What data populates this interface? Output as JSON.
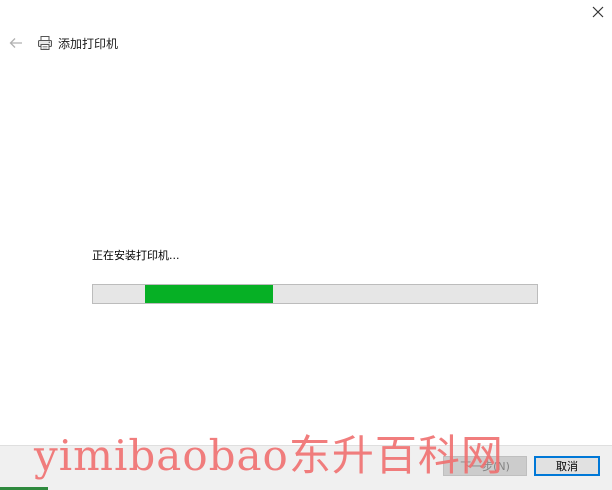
{
  "window": {
    "title": "添加打印机",
    "close_icon": "close-icon",
    "back_icon": "back-arrow-icon",
    "printer_icon": "printer-icon"
  },
  "main": {
    "status_text": "正在安装打印机...",
    "progress": {
      "start_fraction": 0.117,
      "end_fraction": 0.405,
      "fill_color": "#06b025",
      "track_color": "#e6e6e6"
    }
  },
  "footer": {
    "next_label": "下一步(N)",
    "next_enabled": false,
    "cancel_label": "取消"
  },
  "watermark": {
    "text": "yimibaobao东升百科网",
    "color": "#f07070"
  }
}
